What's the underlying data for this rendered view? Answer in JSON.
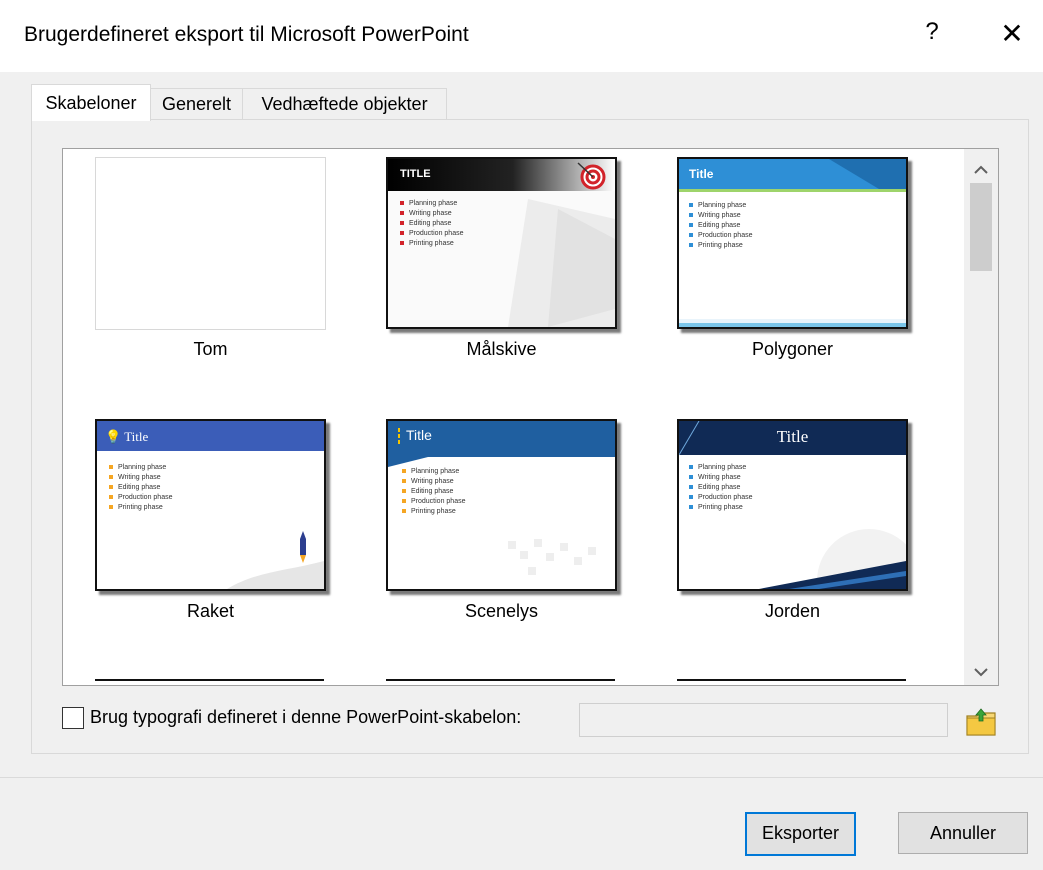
{
  "window": {
    "title": "Brugerdefineret eksport til Microsoft PowerPoint",
    "help": "?",
    "close": "✕"
  },
  "tabs": [
    {
      "label": "Skabeloner",
      "active": true
    },
    {
      "label": "Generelt",
      "active": false
    },
    {
      "label": "Vedhæftede objekter",
      "active": false
    }
  ],
  "templates": [
    {
      "label": "Tom"
    },
    {
      "label": "Målskive",
      "slide_title": "TITLE"
    },
    {
      "label": "Polygoner",
      "slide_title": "Title"
    },
    {
      "label": "Raket",
      "slide_title": "Title"
    },
    {
      "label": "Scenelys",
      "slide_title": "Title"
    },
    {
      "label": "Jorden",
      "slide_title": "Title"
    }
  ],
  "phases": [
    "Planning phase",
    "Writing phase",
    "Editing phase",
    "Production phase",
    "Printing phase"
  ],
  "typography": {
    "checkbox_label": "Brug typografi defineret i denne PowerPoint-skabelon:",
    "checked": false,
    "path_value": ""
  },
  "buttons": {
    "export": "Eksporter",
    "cancel": "Annuller"
  },
  "colors": {
    "accent": "#0078d7",
    "red": "#d2232a",
    "polygon_blue": "#2e8fd6",
    "rocket_blue": "#3b5db8",
    "navy": "#102a55"
  }
}
